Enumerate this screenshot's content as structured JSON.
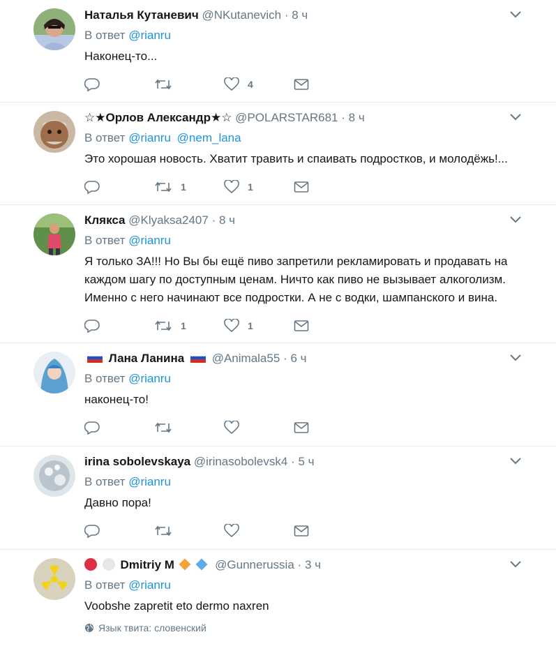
{
  "tweets": [
    {
      "name": "Наталья Кутаневич",
      "handle": "@NKutanevich",
      "time": "8 ч",
      "reply_prefix": "В ответ",
      "mentions": [
        "@rianru"
      ],
      "text": "Наконец-то...",
      "retweets": "",
      "likes": "4"
    },
    {
      "name": "☆★Орлов Александр★☆",
      "handle": "@POLARSTAR681",
      "time": "8 ч",
      "reply_prefix": "В ответ",
      "mentions": [
        "@rianru",
        "@nem_lana"
      ],
      "text": "Это хорошая новость. Хватит травить и спаивать подростков, и молодёжь!...",
      "retweets": "1",
      "likes": "1"
    },
    {
      "name": "Клякса",
      "handle": "@Klyaksa2407",
      "time": "8 ч",
      "reply_prefix": "В ответ",
      "mentions": [
        "@rianru"
      ],
      "text": "Я только ЗА!!! Но Вы бы ещё пиво запретили рекламировать и продавать на каждом шагу по доступным ценам. Ничто как пиво не вызывает алкоголизм. Именно с него начинают все подростки. А не с водки, шампанского и вина.",
      "retweets": "1",
      "likes": "1"
    },
    {
      "name": "Лана Ланина",
      "handle": "@Animala55",
      "time": "6 ч",
      "reply_prefix": "В ответ",
      "mentions": [
        "@rianru"
      ],
      "text": "наконец-то!",
      "retweets": "",
      "likes": ""
    },
    {
      "name": "irina sobolevskaya",
      "handle": "@irinasobolevsk4",
      "time": "5 ч",
      "reply_prefix": "В ответ",
      "mentions": [
        "@rianru"
      ],
      "text": "Давно пора!",
      "retweets": "",
      "likes": ""
    },
    {
      "name": "Dmitriy M",
      "handle": "@Gunnerussia",
      "time": "3 ч",
      "reply_prefix": "В ответ",
      "mentions": [
        "@rianru"
      ],
      "text": "Voobshe zapretit eto dermo naxren",
      "language_note": "Язык твита: словенский",
      "retweets": "",
      "likes": ""
    }
  ],
  "colors": {
    "link": "#1b95e0",
    "secondary": "#657786",
    "divider": "#e6ecf0"
  }
}
